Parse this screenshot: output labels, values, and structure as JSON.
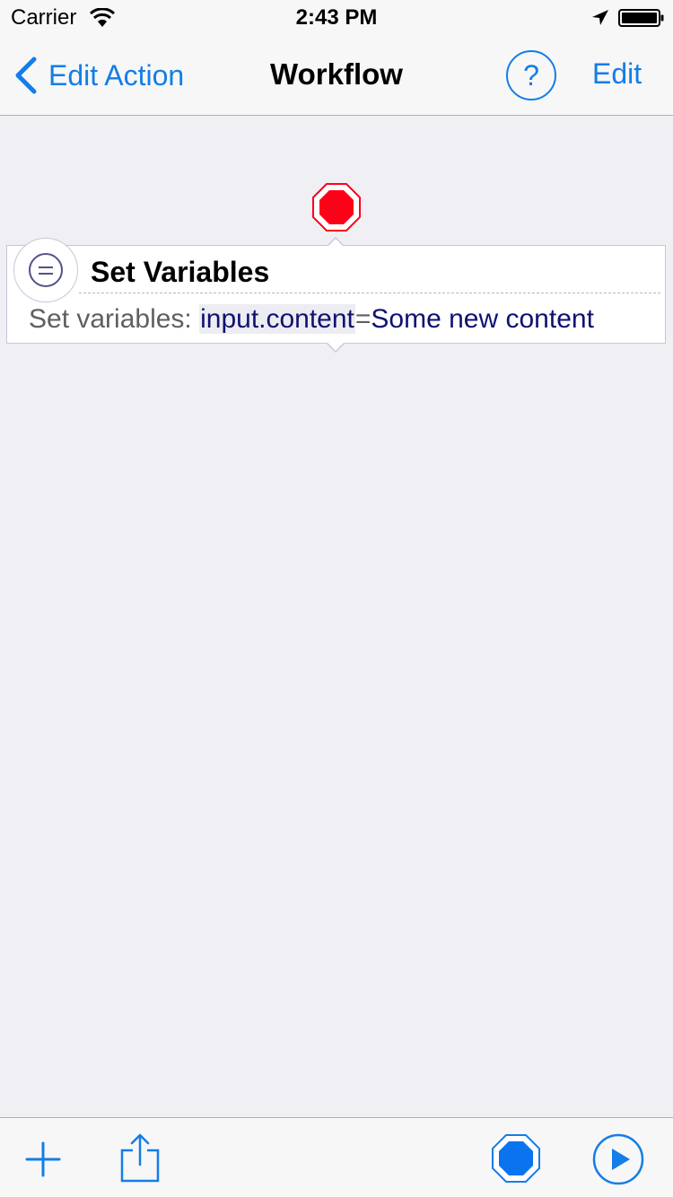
{
  "status_bar": {
    "carrier": "Carrier",
    "time": "2:43 PM",
    "icons": [
      "wifi-icon",
      "location-arrow-icon",
      "battery-icon"
    ]
  },
  "nav": {
    "back_label": "Edit Action",
    "title": "Workflow",
    "help_label": "?",
    "edit_label": "Edit"
  },
  "action": {
    "title": "Set Variables",
    "param_label": "Set variables: ",
    "variable_name": "input.content",
    "equals": "=",
    "variable_value": "Some new content",
    "icon": "set-variables-icon"
  },
  "toolbar": {
    "icons": [
      "add-icon",
      "share-icon",
      "stop-icon",
      "play-icon"
    ]
  },
  "colors": {
    "accent": "#137de8",
    "stop_red": "#ff0019",
    "stop_blue": "#0a74f0",
    "background": "#efeff4",
    "bar": "#f7f7f7",
    "variable_text": "#0e1270"
  }
}
